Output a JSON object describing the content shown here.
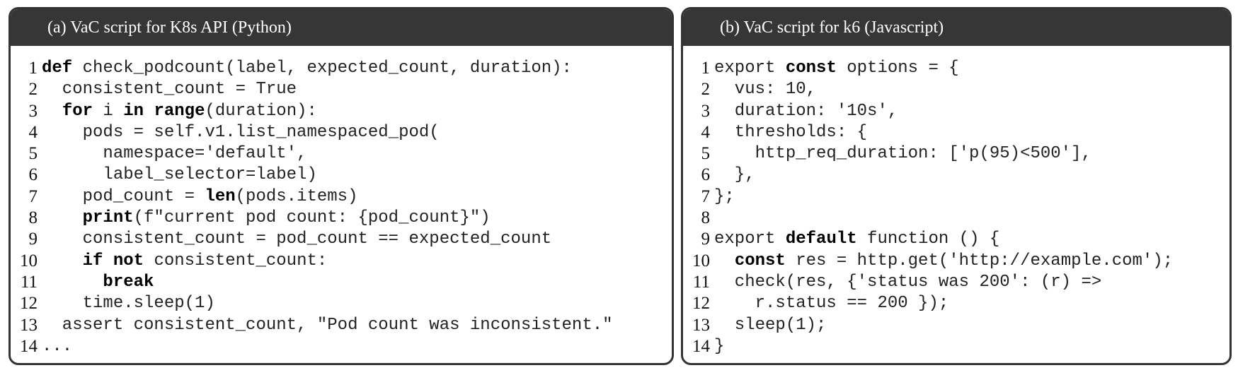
{
  "panels": [
    {
      "title": "(a) VaC script for K8s API (Python)",
      "lines": [
        {
          "n": "1",
          "t": [
            {
              "k": "def"
            },
            " check_podcount(label, expected_count, duration):"
          ]
        },
        {
          "n": "2",
          "t": [
            "  consistent_count = True"
          ]
        },
        {
          "n": "3",
          "t": [
            "  ",
            {
              "k": "for"
            },
            " i ",
            {
              "k": "in"
            },
            " ",
            {
              "k": "range"
            },
            "(duration):"
          ]
        },
        {
          "n": "4",
          "t": [
            "    pods = self.v1.list_namespaced_pod("
          ]
        },
        {
          "n": "5",
          "t": [
            "      namespace='default',"
          ]
        },
        {
          "n": "6",
          "t": [
            "      label_selector=label)"
          ]
        },
        {
          "n": "7",
          "t": [
            "    pod_count = ",
            {
              "k": "len"
            },
            "(pods.items)"
          ]
        },
        {
          "n": "8",
          "t": [
            "    ",
            {
              "k": "print"
            },
            "(f\"current pod count: {pod_count}\")"
          ]
        },
        {
          "n": "9",
          "t": [
            "    consistent_count = pod_count == expected_count"
          ]
        },
        {
          "n": "10",
          "t": [
            "    ",
            {
              "k": "if"
            },
            " ",
            {
              "k": "not"
            },
            " consistent_count:"
          ]
        },
        {
          "n": "11",
          "t": [
            "      ",
            {
              "k": "break"
            }
          ]
        },
        {
          "n": "12",
          "t": [
            "    time.sleep(1)"
          ]
        },
        {
          "n": "13",
          "t": [
            "  assert consistent_count, \"Pod count was inconsistent.\""
          ]
        },
        {
          "n": "14",
          "t": [
            "..."
          ]
        }
      ]
    },
    {
      "title": "(b) VaC script for k6 (Javascript)",
      "lines": [
        {
          "n": "1",
          "t": [
            "export ",
            {
              "k": "const"
            },
            " options = {"
          ]
        },
        {
          "n": "2",
          "t": [
            "  vus: 10,"
          ]
        },
        {
          "n": "3",
          "t": [
            "  duration: '10s',"
          ]
        },
        {
          "n": "4",
          "t": [
            "  thresholds: {"
          ]
        },
        {
          "n": "5",
          "t": [
            "    http_req_duration: ['p(95)<500'],"
          ]
        },
        {
          "n": "6",
          "t": [
            "  },"
          ]
        },
        {
          "n": "7",
          "t": [
            "};"
          ]
        },
        {
          "n": "8",
          "t": [
            ""
          ]
        },
        {
          "n": "9",
          "t": [
            "export ",
            {
              "k": "default"
            },
            " function () {"
          ]
        },
        {
          "n": "10",
          "t": [
            "  ",
            {
              "k": "const"
            },
            " res = http.get('http://example.com');"
          ]
        },
        {
          "n": "11",
          "t": [
            "  check(res, {'status was 200': (r) =>"
          ]
        },
        {
          "n": "12",
          "t": [
            "    r.status == 200 });"
          ]
        },
        {
          "n": "13",
          "t": [
            "  sleep(1);"
          ]
        },
        {
          "n": "14",
          "t": [
            "}"
          ]
        }
      ]
    }
  ]
}
